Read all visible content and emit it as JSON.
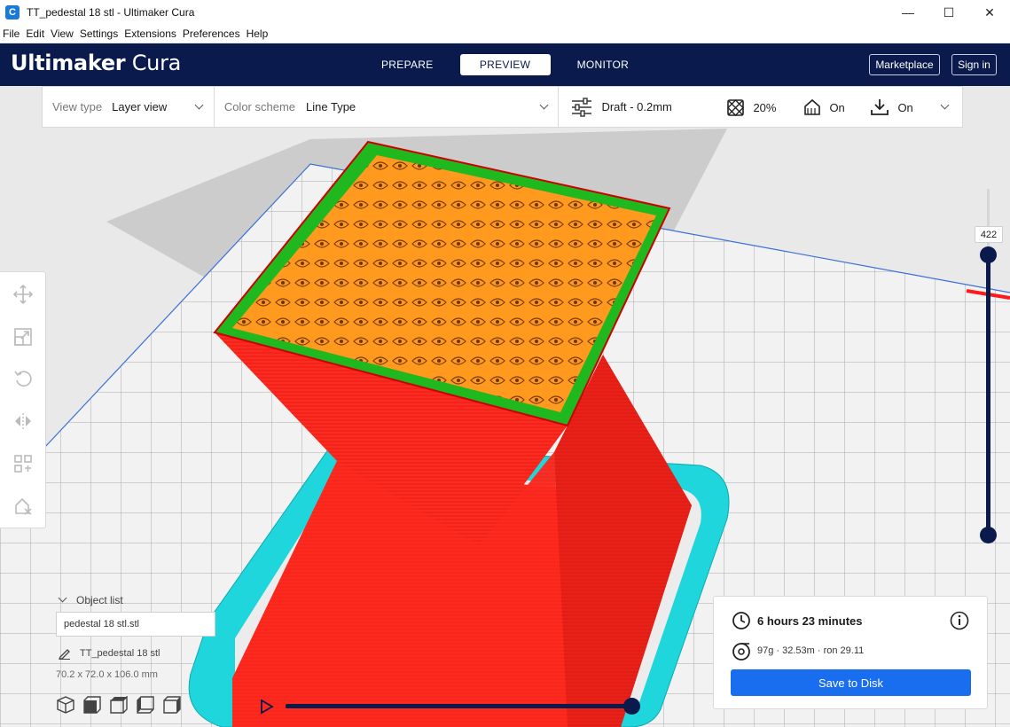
{
  "window": {
    "title": "TT_pedestal 18 stl - Ultimaker Cura",
    "icon": "C",
    "controls": {
      "minimize": "—",
      "maximize": "☐",
      "close": "✕"
    }
  },
  "menu": [
    "File",
    "Edit",
    "View",
    "Settings",
    "Extensions",
    "Preferences",
    "Help"
  ],
  "header": {
    "logo_bold": "Ultimaker",
    "logo_light": "Cura",
    "tabs": [
      "PREPARE",
      "PREVIEW",
      "MONITOR"
    ],
    "active_tab": "PREVIEW",
    "marketplace": "Marketplace",
    "signin": "Sign in"
  },
  "toolbar": {
    "view_type_label": "View type",
    "view_type_value": "Layer view",
    "color_scheme_label": "Color scheme",
    "color_scheme_value": "Line Type",
    "profile": "Draft - 0.2mm",
    "infill": "20%",
    "support": "On",
    "adhesion": "On"
  },
  "tools": [
    "move-icon",
    "scale-icon",
    "rotate-icon",
    "mirror-icon",
    "per-model-settings-icon",
    "support-blocker-icon"
  ],
  "layer_slider": {
    "value": "422",
    "position_fraction": 0
  },
  "object_list": {
    "title": "Object list",
    "item": "pedestal 18 stl.stl",
    "object_name": "TT_pedestal 18 stl",
    "dimensions": "70.2 x 72.0 x 106.0 mm"
  },
  "camera_views": [
    "3d-view-icon",
    "front-view-icon",
    "top-view-icon",
    "left-view-icon",
    "right-view-icon"
  ],
  "simulation": {
    "progress_fraction": 1.0
  },
  "output": {
    "time": "6 hours 23 minutes",
    "material": "97g · 32.53m · ron 29.11",
    "save_label": "Save to Disk"
  },
  "colors": {
    "header": "#0a1a4d",
    "accent": "#196ef0",
    "wall": "#ff2020",
    "infill": "#ff9a1f",
    "skin": "#22dd22",
    "skirt": "#22d3d8"
  }
}
